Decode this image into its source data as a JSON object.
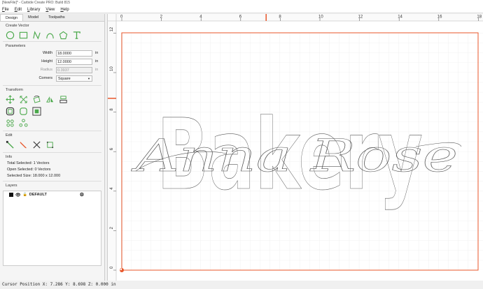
{
  "window": {
    "title": "[NewFile]* - Carbide Create PRO: Build 815"
  },
  "menu": [
    "File",
    "Edit",
    "Library",
    "View",
    "Help"
  ],
  "tabs": [
    "Design",
    "Model",
    "Toolpaths"
  ],
  "create_vector": {
    "title": "Create Vector"
  },
  "parameters": {
    "title": "Parameters",
    "width_label": "Width",
    "width_value": "18.0000",
    "width_unit": "in",
    "height_label": "Height",
    "height_value": "12.0000",
    "height_unit": "in",
    "radius_label": "Radius",
    "radius_value": "0.3937",
    "radius_unit": "in",
    "corners_label": "Corners",
    "corners_value": "Square"
  },
  "transform": {
    "title": "Transform"
  },
  "edit": {
    "title": "Edit"
  },
  "info": {
    "title": "Info",
    "total_selected": "Total Selected:   1 Vectors",
    "open_selected": "Open Selected:   0 Vectors",
    "selected_size": "Selected Size:    18.000 x 12.000"
  },
  "layers": {
    "title": "Layers",
    "items": [
      {
        "name": "DEFAULT",
        "color": "#111111"
      }
    ]
  },
  "canvas": {
    "x_ticks": [
      "0",
      "2",
      "4",
      "6",
      "8",
      "10",
      "12",
      "14",
      "16",
      "18"
    ],
    "y_ticks": [
      "0",
      "2",
      "4",
      "6",
      "8",
      "10",
      "12"
    ],
    "cursor_x": 7.286,
    "cursor_y": 8.698,
    "text_block": "Bakery",
    "text_script": "Anna Rose",
    "accent_color": "#e8562a"
  },
  "status": {
    "text": "Cursor Position X: 7.286 Y: 8.698 Z: 0.000 in"
  }
}
